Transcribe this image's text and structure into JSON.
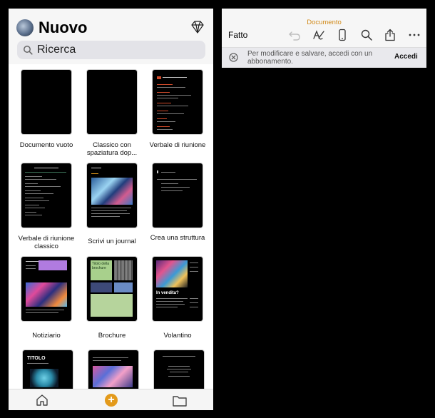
{
  "left": {
    "title": "Nuovo",
    "search": {
      "placeholder": "Ricerca"
    },
    "templates": [
      {
        "name": "Documento vuoto"
      },
      {
        "name": "Classico con spaziatura dop..."
      },
      {
        "name": "Verbale di riunione"
      },
      {
        "name": "Verbale di riunione classico"
      },
      {
        "name": "Scrivi un journal"
      },
      {
        "name": "Crea una struttura"
      },
      {
        "name": "Notiziario"
      },
      {
        "name": "Brochure"
      },
      {
        "name": "Volantino"
      }
    ],
    "thumbs": {
      "brochure_heading": "Titolo della brochure",
      "flyer_heading": "In vendita?",
      "titolo_card": "TITOLO"
    },
    "tabbar": {
      "add_symbol": "+"
    }
  },
  "right": {
    "doc_title": "Documento",
    "done_label": "Fatto",
    "banner_text": "Per modificare e salvare, accedi con un abbonamento.",
    "login_label": "Accedi"
  },
  "colors": {
    "accent": "#e39a1b",
    "doc_title": "#d18a1a"
  },
  "icons": [
    "search-icon",
    "diamond-icon",
    "undo-icon",
    "pen-icon",
    "phone-icon",
    "share-icon",
    "more-icon",
    "close-circle-icon",
    "home-icon",
    "add-icon",
    "folder-icon"
  ]
}
